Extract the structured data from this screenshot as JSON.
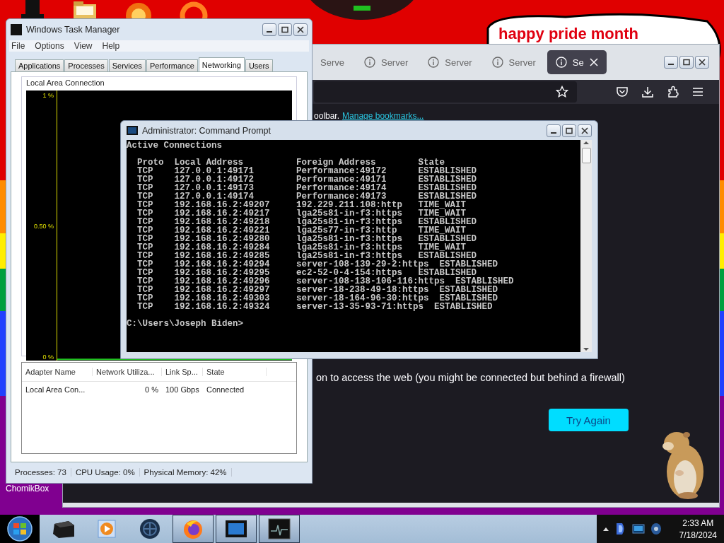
{
  "desktop": {
    "bubble_text": "happy pride month",
    "icons": [
      {
        "kind": "hat"
      },
      {
        "kind": "folder"
      },
      {
        "kind": "ball"
      },
      {
        "kind": "ring"
      }
    ],
    "icon_label": "ChomikBox"
  },
  "browser": {
    "tabs": [
      {
        "kind": "cut",
        "title": "Serve",
        "selected": false
      },
      {
        "kind": "tab",
        "title": "Server",
        "selected": false
      },
      {
        "kind": "tab",
        "title": "Server",
        "selected": false
      },
      {
        "kind": "tab",
        "title": "Server",
        "selected": false
      },
      {
        "kind": "tab",
        "title": "Se",
        "selected": true
      }
    ],
    "bookmarks_hint": "oolbar.",
    "bookmarks_link": "Manage bookmarks...",
    "message": "on to access the web (you might be connected but behind a firewall)",
    "button": "Try Again"
  },
  "task_manager": {
    "title": "Windows Task Manager",
    "menu": [
      "File",
      "Options",
      "View",
      "Help"
    ],
    "tabs": [
      {
        "label": "Applications",
        "selected": false
      },
      {
        "label": "Processes",
        "selected": false
      },
      {
        "label": "Services",
        "selected": false
      },
      {
        "label": "Performance",
        "selected": false
      },
      {
        "label": "Networking",
        "selected": true
      },
      {
        "label": "Users",
        "selected": false
      }
    ],
    "group_title": "Local Area Connection",
    "graph_labels": [
      "1 %",
      "0.50 %",
      "0 %"
    ],
    "columns": [
      "Adapter Name",
      "Network Utiliza...",
      "Link Sp...",
      "State"
    ],
    "rows": [
      [
        "Local Area Con...",
        "0 %",
        "100 Gbps",
        "Connected"
      ]
    ],
    "status": [
      "Processes: 73",
      "CPU Usage: 0%",
      "Physical Memory: 42%"
    ]
  },
  "command_prompt": {
    "title": "Administrator: Command Prompt",
    "heading": "Active Connections",
    "table_header": "  Proto  Local Address          Foreign Address        State",
    "rows": [
      "  TCP    127.0.0.1:49171        Performance:49172      ESTABLISHED",
      "  TCP    127.0.0.1:49172        Performance:49171      ESTABLISHED",
      "  TCP    127.0.0.1:49173        Performance:49174      ESTABLISHED",
      "  TCP    127.0.0.1:49174        Performance:49173      ESTABLISHED",
      "  TCP    192.168.16.2:49207     192.229.211.108:http   TIME_WAIT",
      "  TCP    192.168.16.2:49217     lga25s81-in-f3:https   TIME_WAIT",
      "  TCP    192.168.16.2:49218     lga25s81-in-f3:https   ESTABLISHED",
      "  TCP    192.168.16.2:49221     lga25s77-in-f3:http    TIME_WAIT",
      "  TCP    192.168.16.2:49280     lga25s81-in-f3:https   ESTABLISHED",
      "  TCP    192.168.16.2:49284     lga25s81-in-f3:https   TIME_WAIT",
      "  TCP    192.168.16.2:49285     lga25s81-in-f3:https   ESTABLISHED",
      "  TCP    192.168.16.2:49294     server-108-139-29-2:https  ESTABLISHED",
      "  TCP    192.168.16.2:49295     ec2-52-0-4-154:https   ESTABLISHED",
      "  TCP    192.168.16.2:49296     server-108-138-106-116:https  ESTABLISHED",
      "  TCP    192.168.16.2:49297     server-18-238-49-18:https  ESTABLISHED",
      "  TCP    192.168.16.2:49303     server-18-164-96-30:https  ESTABLISHED",
      "  TCP    192.168.16.2:49324     server-13-35-93-71:https  ESTABLISHED"
    ],
    "prompt": "C:\\Users\\Joseph Biden>"
  },
  "taskbar": {
    "items": [
      {
        "kind": "box",
        "open": false
      },
      {
        "kind": "media",
        "open": false
      },
      {
        "kind": "globe",
        "open": false
      },
      {
        "kind": "firefox",
        "open": true
      },
      {
        "kind": "console",
        "open": true
      },
      {
        "kind": "monitor",
        "open": true
      }
    ],
    "tray": [
      {
        "kind": "badge"
      },
      {
        "kind": "screen"
      },
      {
        "kind": "disc"
      }
    ],
    "time": "2:33 AM",
    "date": "7/18/2024"
  }
}
